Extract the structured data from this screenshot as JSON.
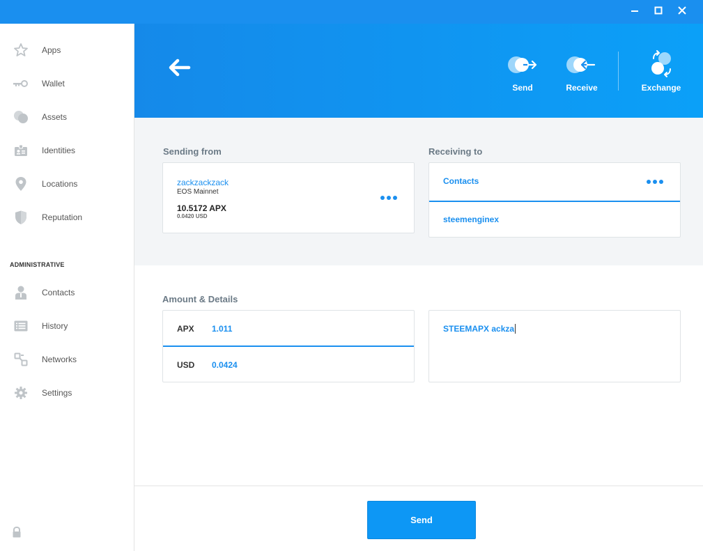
{
  "sidebar": {
    "items": [
      {
        "label": "Apps",
        "icon": "star-icon"
      },
      {
        "label": "Wallet",
        "icon": "key-icon"
      },
      {
        "label": "Assets",
        "icon": "coins-icon"
      },
      {
        "label": "Identities",
        "icon": "id-card-icon"
      },
      {
        "label": "Locations",
        "icon": "location-pin-icon"
      },
      {
        "label": "Reputation",
        "icon": "shield-icon"
      }
    ],
    "admin_heading": "ADMINISTRATIVE",
    "admin_items": [
      {
        "label": "Contacts",
        "icon": "person-icon"
      },
      {
        "label": "History",
        "icon": "list-icon"
      },
      {
        "label": "Networks",
        "icon": "network-icon"
      },
      {
        "label": "Settings",
        "icon": "gear-icon"
      }
    ]
  },
  "header": {
    "actions": {
      "send": "Send",
      "receive": "Receive",
      "exchange": "Exchange"
    }
  },
  "sending_from": {
    "title": "Sending from",
    "account": "zackzackzack",
    "network": "EOS Mainnet",
    "balance": "10.5172 APX",
    "balance_usd": "0.0420 USD"
  },
  "receiving_to": {
    "title": "Receiving to",
    "selector": "Contacts",
    "recipient": "steemenginex"
  },
  "amount": {
    "title": "Amount & Details",
    "token_code": "APX",
    "token_value": "1.011",
    "fiat_code": "USD",
    "fiat_value": "0.0424",
    "memo": "STEEMAPX ackza"
  },
  "footer": {
    "send_label": "Send"
  },
  "colors": {
    "accent": "#1a8fef",
    "header_start": "#1589e9",
    "header_end": "#0ba0f8",
    "content_grey": "#f3f5f7"
  }
}
